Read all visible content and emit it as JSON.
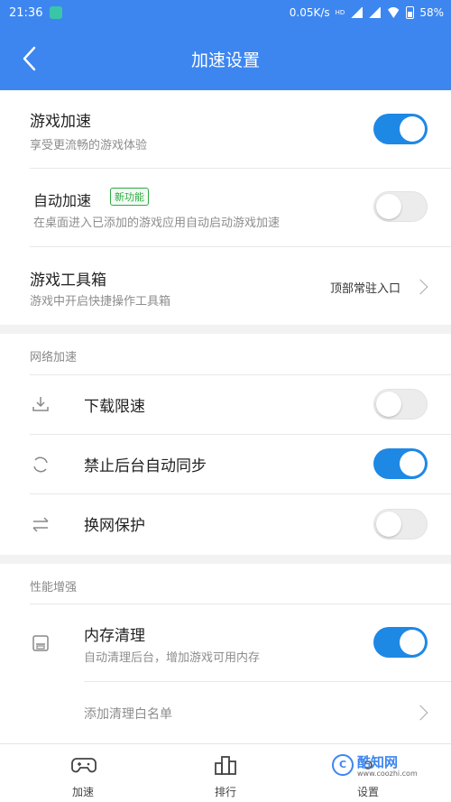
{
  "status": {
    "time": "21:36",
    "speed": "0.05K/s",
    "hd": "HD",
    "battery": "58%"
  },
  "header": {
    "title": "加速设置"
  },
  "game_accel": {
    "title": "游戏加速",
    "subtitle": "享受更流畅的游戏体验",
    "on": true
  },
  "auto_accel": {
    "title": "自动加速",
    "badge": "新功能",
    "subtitle": "在桌面进入已添加的游戏应用自动启动游戏加速",
    "on": false
  },
  "toolbox": {
    "title": "游戏工具箱",
    "subtitle": "游戏中开启快捷操作工具箱",
    "value": "顶部常驻入口"
  },
  "network": {
    "section_label": "网络加速",
    "items": [
      {
        "label": "下载限速",
        "icon": "download-icon",
        "on": false
      },
      {
        "label": "禁止后台自动同步",
        "icon": "sync-icon",
        "on": true
      },
      {
        "label": "换网保护",
        "icon": "switch-network-icon",
        "on": false
      }
    ]
  },
  "performance": {
    "section_label": "性能增强",
    "memory": {
      "label": "内存清理",
      "subtitle": "自动清理后台，增加游戏可用内存",
      "icon": "memory-icon",
      "on": true
    },
    "whitelist": {
      "label": "添加清理白名单"
    }
  },
  "tabbar": {
    "items": [
      {
        "label": "加速",
        "icon": "gamepad-icon"
      },
      {
        "label": "排行",
        "icon": "ranking-icon"
      },
      {
        "label": "设置",
        "icon": "settings-icon"
      }
    ]
  },
  "watermark": {
    "logo_text": "C",
    "name": "酷知网",
    "url": "www.coozhi.com"
  },
  "colors": {
    "accent": "#3d86f0",
    "toggle_on": "#1e88e5",
    "badge": "#2eaa43"
  }
}
